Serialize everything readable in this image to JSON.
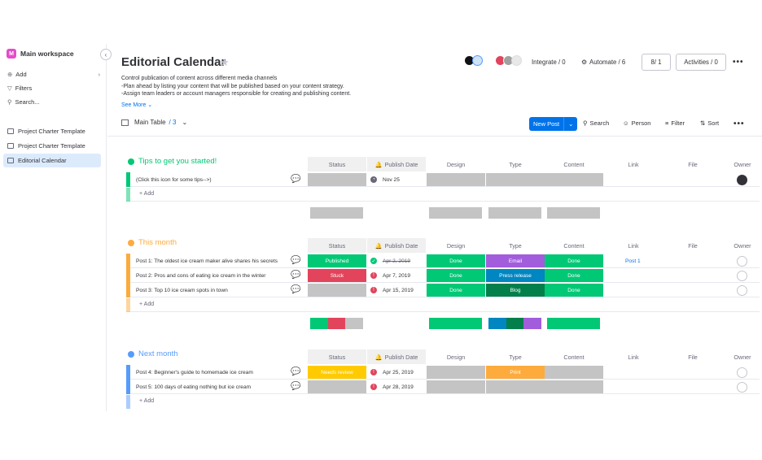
{
  "sidebar": {
    "workspace_letter": "M",
    "workspace_name": "Main workspace",
    "collapse_glyph": "‹",
    "nav": [
      {
        "icon": "add-icon",
        "glyph": "⊕",
        "label": "Add"
      },
      {
        "icon": "filter-icon",
        "glyph": "▽",
        "label": "Filters"
      },
      {
        "icon": "search-icon",
        "glyph": "⚲",
        "label": "Search..."
      }
    ],
    "add_chevron": "›",
    "boards": [
      {
        "label": "Project Charter Template",
        "active": false
      },
      {
        "label": "Project Charter Template",
        "active": false
      },
      {
        "label": "Editorial Calendar",
        "active": true
      }
    ]
  },
  "header": {
    "title": "Editorial Calendar",
    "star_glyph": "★",
    "description": [
      "Control publication of content across different media channels",
      "-Plan ahead by listing your content that will be published based on your content strategy.",
      "-Assign team leaders or account managers responsible for creating and publishing content."
    ],
    "see_more": "See More ⌄",
    "integrate": "Integrate / 0",
    "automate": "Automate / 6",
    "members": "8/ 1",
    "activities": "Activities / 0",
    "more_glyph": "•••"
  },
  "toolbar": {
    "table_label": "Main Table",
    "table_count": "/ 3",
    "table_chevron": "⌄",
    "new_post": "New Post",
    "new_post_chevron": "⌄",
    "search": "Search",
    "person": "Person",
    "filter": "Filter",
    "sort": "Sort",
    "more_glyph": "•••"
  },
  "columns": {
    "status": "Status",
    "publish_date": "Publish Date",
    "design": "Design",
    "type": "Type",
    "content": "Content",
    "link": "Link",
    "file": "File",
    "owner": "Owner"
  },
  "colors": {
    "green": "#00c875",
    "yellow": "#fdab3d",
    "blue": "#579bfc",
    "done": "#00c875",
    "stuck": "#e2445c",
    "purple": "#a25ddc",
    "navy": "#0086c0",
    "darkgreen": "#037f4c",
    "grey": "#c4c4c4",
    "needs_review": "#ffcb00",
    "orange": "#fdab3d"
  },
  "groups": [
    {
      "title": "Tips to get you started!",
      "rows": [
        {
          "name": "(Click this icon for some tips-->)",
          "date": "Nov 25",
          "date_state": "clock",
          "link": "",
          "owner_filled": true
        }
      ],
      "add_label": "+ Add"
    },
    {
      "title": "This month",
      "rows": [
        {
          "name": "Post 1: The oldest ice cream maker alive shares his secrets",
          "status": "Published",
          "date": "Apr 2, 2019",
          "date_state": "done",
          "design": "Done",
          "type": "Email",
          "content": "Done",
          "link": "Post 1"
        },
        {
          "name": "Post 2: Pros and cons of eating ice cream in the winter",
          "status": "Stuck",
          "date": "Apr 7, 2019",
          "date_state": "alert",
          "design": "Done",
          "type": "Press release",
          "content": "Done",
          "link": ""
        },
        {
          "name": "Post 3: Top 10 ice cream spots in town",
          "status": "",
          "date": "Apr 15, 2019",
          "date_state": "alert",
          "design": "Done",
          "type": "Blog",
          "content": "Done",
          "link": ""
        }
      ],
      "add_label": "+ Add"
    },
    {
      "title": "Next month",
      "rows": [
        {
          "name": "Post 4: Beginner's guide to homemade ice cream",
          "status": "Needs review",
          "date": "Apr 25, 2019",
          "date_state": "alert",
          "design": "",
          "type": "Print",
          "content": "",
          "link": ""
        },
        {
          "name": "Post 5: 100 days of eating nothing but ice cream",
          "status": "",
          "date": "Apr 28, 2019",
          "date_state": "alert",
          "design": "",
          "type": "",
          "content": "",
          "link": ""
        }
      ],
      "add_label": "+ Add"
    }
  ]
}
